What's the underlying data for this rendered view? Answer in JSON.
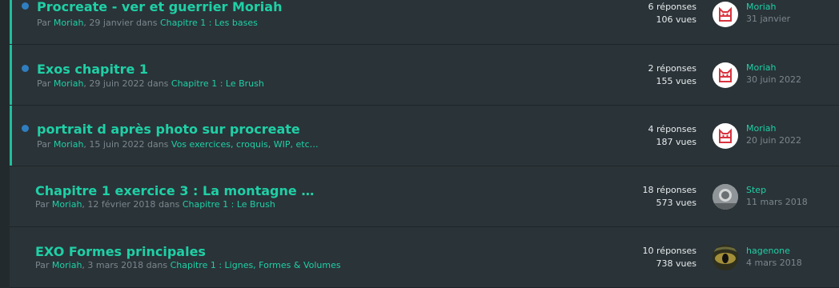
{
  "colors": {
    "accent": "#1fd0a6",
    "unread_dot": "#2f7ec0",
    "row_bg": "#2a3338",
    "page_bg": "#232a2e"
  },
  "topics": [
    {
      "title": "Procreate - ver et guerrier Moriah",
      "by_prefix": "Par",
      "author": "Moriah",
      "date": "29 janvier",
      "in_word": "dans",
      "category": "Chapitre 1 : Les bases",
      "replies": "6 réponses",
      "views": "106 vues",
      "last_user": "Moriah",
      "last_date": "31 janvier",
      "avatar_icon": "moriah-cat-avatar-icon",
      "unread": true
    },
    {
      "title": "Exos chapitre 1",
      "by_prefix": "Par",
      "author": "Moriah",
      "date": "29 juin 2022",
      "in_word": "dans",
      "category": "Chapitre 1 : Le Brush",
      "replies": "2 réponses",
      "views": "155 vues",
      "last_user": "Moriah",
      "last_date": "30 juin 2022",
      "avatar_icon": "moriah-cat-avatar-icon",
      "unread": true
    },
    {
      "title": "portrait d après photo sur procreate",
      "by_prefix": "Par",
      "author": "Moriah",
      "date": "15 juin 2022",
      "in_word": "dans",
      "category": "Vos exercices, croquis, WIP, etc…",
      "replies": "4 réponses",
      "views": "187 vues",
      "last_user": "Moriah",
      "last_date": "20 juin 2022",
      "avatar_icon": "moriah-cat-avatar-icon",
      "unread": true
    },
    {
      "title": "Chapitre 1 exercice 3 : La montagne …",
      "by_prefix": "Par",
      "author": "Moriah",
      "date": "12 février 2018",
      "in_word": "dans",
      "category": "Chapitre 1 : Le Brush",
      "replies": "18 réponses",
      "views": "573 vues",
      "last_user": "Step",
      "last_date": "11 mars 2018",
      "avatar_icon": "step-photo-avatar-icon",
      "unread": false
    },
    {
      "title": "EXO Formes principales",
      "by_prefix": "Par",
      "author": "Moriah",
      "date": "3 mars 2018",
      "in_word": "dans",
      "category": "Chapitre 1 : Lignes, Formes & Volumes",
      "replies": "10 réponses",
      "views": "738 vues",
      "last_user": "hagenone",
      "last_date": "4 mars 2018",
      "avatar_icon": "hagenone-eye-avatar-icon",
      "unread": false
    }
  ]
}
